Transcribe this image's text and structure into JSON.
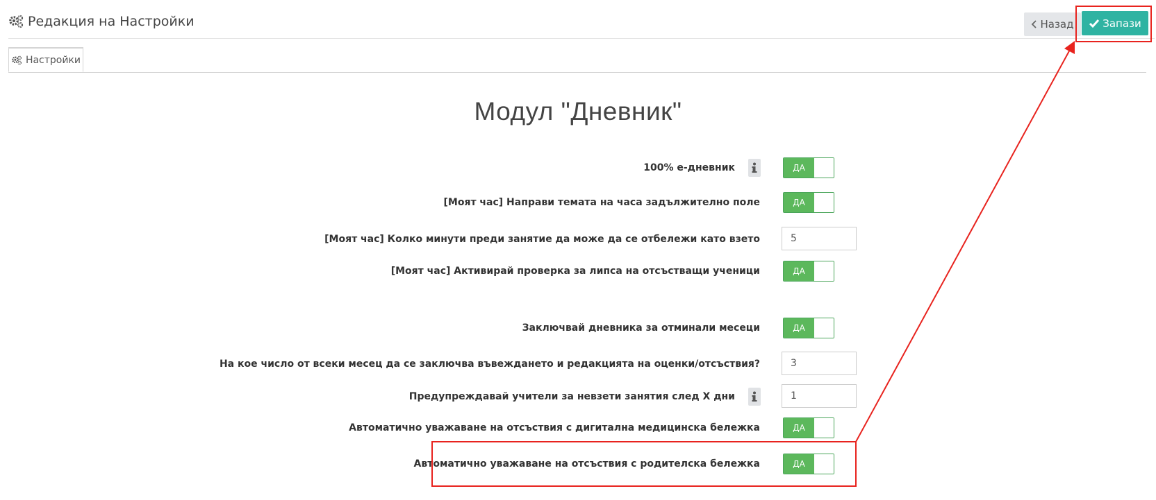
{
  "header": {
    "title": "Редакция на Настройки",
    "back_label": "Назад",
    "save_label": "Запази"
  },
  "tabs": [
    {
      "label": "Настройки",
      "active": true
    }
  ],
  "section": {
    "title": "Модул \"Дневник\""
  },
  "settings": [
    {
      "label": "100% е-дневник",
      "type": "toggle",
      "value": "ДА",
      "info": true
    },
    {
      "label": "[Моят час] Направи темата на часа задължително поле",
      "type": "toggle",
      "value": "ДА"
    },
    {
      "label": "[Моят час] Колко минути преди занятие да може да се отбележи като взето",
      "type": "number",
      "value": "5"
    },
    {
      "label": "[Моят час] Активирай проверка за липса на отсъстващи ученици",
      "type": "toggle",
      "value": "ДА"
    },
    {
      "label": "Заключвай дневника за отминали месеци",
      "type": "toggle",
      "value": "ДА"
    },
    {
      "label": "На кое число от всеки месец да се заключва въвеждането и редакцията на оценки/отсъствия?",
      "type": "number",
      "value": "3"
    },
    {
      "label": "Предупреждавай учители за невзети занятия след Х дни",
      "type": "number",
      "value": "1",
      "info": true
    },
    {
      "label": "Автоматично уважаване на отсъствия с дигитална медицинска бележка",
      "type": "toggle",
      "value": "ДА"
    },
    {
      "label": "Автоматично уважаване на отсъствия с родителска бележка",
      "type": "toggle",
      "value": "ДА"
    }
  ],
  "colors": {
    "save_button": "#2fb3a2",
    "toggle_on": "#5cb85c",
    "annotation": "#e8231e"
  },
  "icons": {
    "title": "gears-icon",
    "tab": "gears-icon",
    "back": "chevron-left-icon",
    "save": "check-icon",
    "info": "info-icon"
  }
}
